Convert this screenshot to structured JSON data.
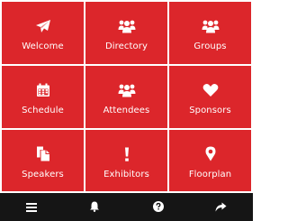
{
  "colors": {
    "tile": "#dc262b",
    "bar": "#151515",
    "icon": "#ffffff"
  },
  "tiles": [
    {
      "label": "Welcome",
      "icon": "paper-plane-icon"
    },
    {
      "label": "Directory",
      "icon": "people-group-icon"
    },
    {
      "label": "Groups",
      "icon": "people-group-icon"
    },
    {
      "label": "Schedule",
      "icon": "calendar-icon"
    },
    {
      "label": "Attendees",
      "icon": "people-group-icon"
    },
    {
      "label": "Sponsors",
      "icon": "heart-icon"
    },
    {
      "label": "Speakers",
      "icon": "documents-icon"
    },
    {
      "label": "Exhibitors",
      "icon": "exclamation-icon"
    },
    {
      "label": "Floorplan",
      "icon": "map-marker-icon"
    }
  ],
  "bottom_bar": [
    {
      "icon": "menu-icon"
    },
    {
      "icon": "bell-icon"
    },
    {
      "icon": "help-icon"
    },
    {
      "icon": "share-icon"
    }
  ]
}
